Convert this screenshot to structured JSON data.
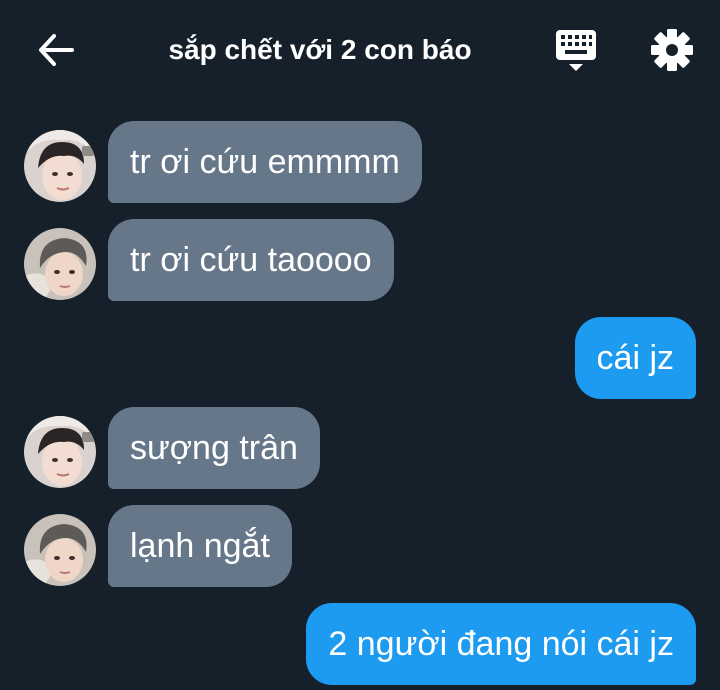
{
  "header": {
    "back_icon": "arrow-left-icon",
    "title": "sắp chết với 2 con báo",
    "keyboard_icon": "keyboard-icon",
    "settings_icon": "gear-icon"
  },
  "colors": {
    "background": "#15202b",
    "incoming_bubble": "#66778a",
    "outgoing_bubble": "#1d9bf0",
    "text": "#ffffff"
  },
  "messages": [
    {
      "direction": "incoming",
      "sender_avatar": "avatar-1",
      "text": "tr ơi cứu emmmm"
    },
    {
      "direction": "incoming",
      "sender_avatar": "avatar-2",
      "text": "tr ơi cứu taoooo"
    },
    {
      "direction": "outgoing",
      "text": "cái jz"
    },
    {
      "direction": "incoming",
      "sender_avatar": "avatar-1",
      "text": "sượng trân"
    },
    {
      "direction": "incoming",
      "sender_avatar": "avatar-2",
      "text": "lạnh ngắt"
    },
    {
      "direction": "outgoing",
      "text": "2 người đang nói cái jz"
    }
  ]
}
